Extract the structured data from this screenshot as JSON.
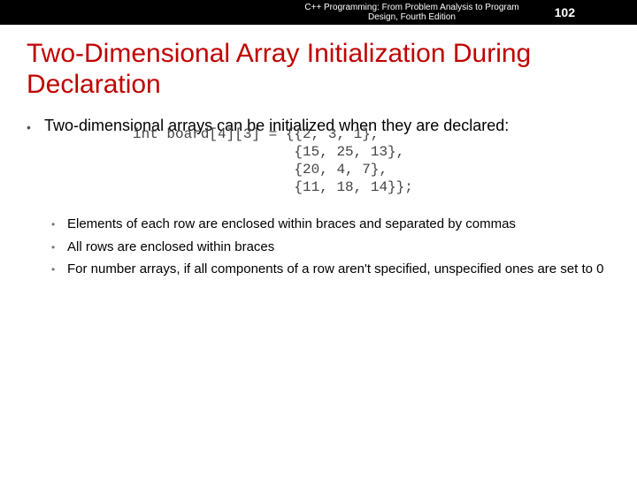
{
  "header": {
    "book_title": "C++ Programming: From Problem Analysis to Program\nDesign, Fourth Edition",
    "page_number": "102"
  },
  "title": "Two-Dimensional Array Initialization During Declaration",
  "bullet1": {
    "lead": "Two-dimensional arrays can be initialized when they are declared:",
    "code": "int board[4][3] = {{2, 3, 1},\n                   {15, 25, 13},\n                   {20, 4, 7},\n                   {11, 18, 14}};"
  },
  "sub_bullets": [
    "Elements of each row are enclosed within braces and separated by commas",
    "All rows are enclosed within braces",
    "For number arrays, if all components of a row aren't specified, unspecified ones are set to 0"
  ],
  "chart_data": {
    "type": "table",
    "name": "board",
    "rows": 4,
    "cols": 3,
    "values": [
      [
        2,
        3,
        1
      ],
      [
        15,
        25,
        13
      ],
      [
        20,
        4,
        7
      ],
      [
        11,
        18,
        14
      ]
    ]
  }
}
